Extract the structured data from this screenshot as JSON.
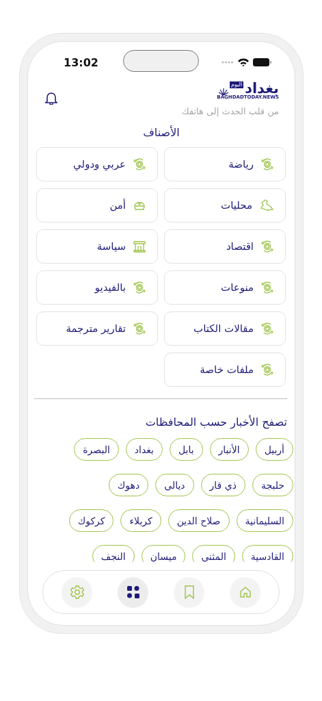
{
  "status_bar": {
    "time": "13:02"
  },
  "header": {
    "logo": {
      "name": "بغداد",
      "tag": "اليوم",
      "domain": "BAGHDADTODAY.NEWS"
    },
    "tagline": "من قلب الحدث إلى هاتفك"
  },
  "categories": {
    "title": "الأصناف",
    "items": [
      {
        "label": "رياضة",
        "kind": "money"
      },
      {
        "label": "عربي ودولي",
        "kind": "money"
      },
      {
        "label": "محليات",
        "kind": "map"
      },
      {
        "label": "أمن",
        "kind": "cap"
      },
      {
        "label": "اقتصاد",
        "kind": "money"
      },
      {
        "label": "سياسة",
        "kind": "building"
      },
      {
        "label": "منوعات",
        "kind": "money"
      },
      {
        "label": "بالفيديو",
        "kind": "money"
      },
      {
        "label": "مقالات الكتاب",
        "kind": "money"
      },
      {
        "label": "تقارير مترجمة",
        "kind": "money"
      },
      {
        "label": "ملفات خاصة",
        "kind": "money"
      }
    ]
  },
  "governorates": {
    "title": "تصفح الأخبار حسب المحافظات",
    "items": [
      "أربيل",
      "الأنبار",
      "بابل",
      "بغداد",
      "البصرة",
      "حلبجة",
      "ذي قار",
      "ديالى",
      "دهوك",
      "السليمانية",
      "صلاح الدين",
      "كربلاء",
      "كركوك",
      "القادسية",
      "المثنى",
      "ميسان",
      "النجف"
    ]
  },
  "nav": [
    {
      "kind": "home",
      "selected": false
    },
    {
      "kind": "bookmark",
      "selected": false
    },
    {
      "kind": "grid",
      "selected": true
    },
    {
      "kind": "settings",
      "selected": false
    }
  ]
}
